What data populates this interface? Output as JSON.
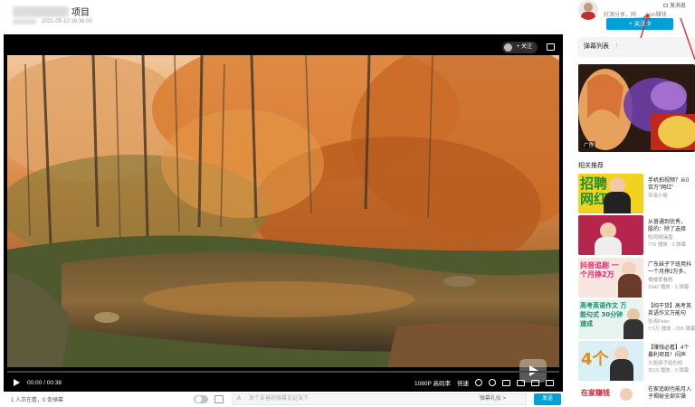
{
  "header": {
    "title": "项目",
    "date": "2021-05-10 16:36:05"
  },
  "player": {
    "follow_label": "+ 关注",
    "time_current": "00:00",
    "time_total": "00:38",
    "quality": "1080P 高码率",
    "speed": "倍速",
    "progress": 0
  },
  "bottom": {
    "viewers": "1 人正在看，0 条弹幕",
    "danmaku_placeholder": "发个友善的弹幕见证当下",
    "etiquette": "弹幕礼仪 >",
    "send": "发送"
  },
  "sidebar": {
    "message": "发消息",
    "up_desc": "好源分享，网___gam赚钱",
    "follow": "+ 关注 9",
    "danmaku_list": "弹幕列表",
    "ad_tag": "广告",
    "recommend_title": "相关推荐",
    "items": [
      {
        "thumb_text": "招聘 网红",
        "title1": "手机拍视频？从0",
        "title2": "百万\"网红\"",
        "up": "导演小筱",
        "stats": ""
      },
      {
        "thumb_text": "",
        "title1": "从普通到优秀，",
        "title2": "股的：除了选择",
        "up": "短视频操盘",
        "stats": "776 播放 · 0 弹幕"
      },
      {
        "thumb_text": "抖音追剧 一个月挣2万",
        "title1": "广东妹子下班用抖",
        "title2": "一个月挣2万多，",
        "up": "楼楼爱看剧",
        "stats": "1942 播放 · 1 弹幕"
      },
      {
        "thumb_text": "高考英语作文 万能句式 30分钟速成",
        "title1": "【纯干货】高考英",
        "title2": "英语作文万能句",
        "up": "张涛Peter",
        "stats": "7.5万 播放 · 355 弹幕"
      },
      {
        "thumb_text": "4个",
        "title1": "【赚钱必看】4个",
        "title2": "暴利项目！闷声",
        "up": "大姐骑子给的妆",
        "stats": "3515 播放 · 0 弹幕"
      },
      {
        "thumb_text": "在家赚钱",
        "title1": "在家追剧也能月入",
        "title2": "子揭秘全部实操",
        "up": "",
        "stats": ""
      }
    ]
  }
}
